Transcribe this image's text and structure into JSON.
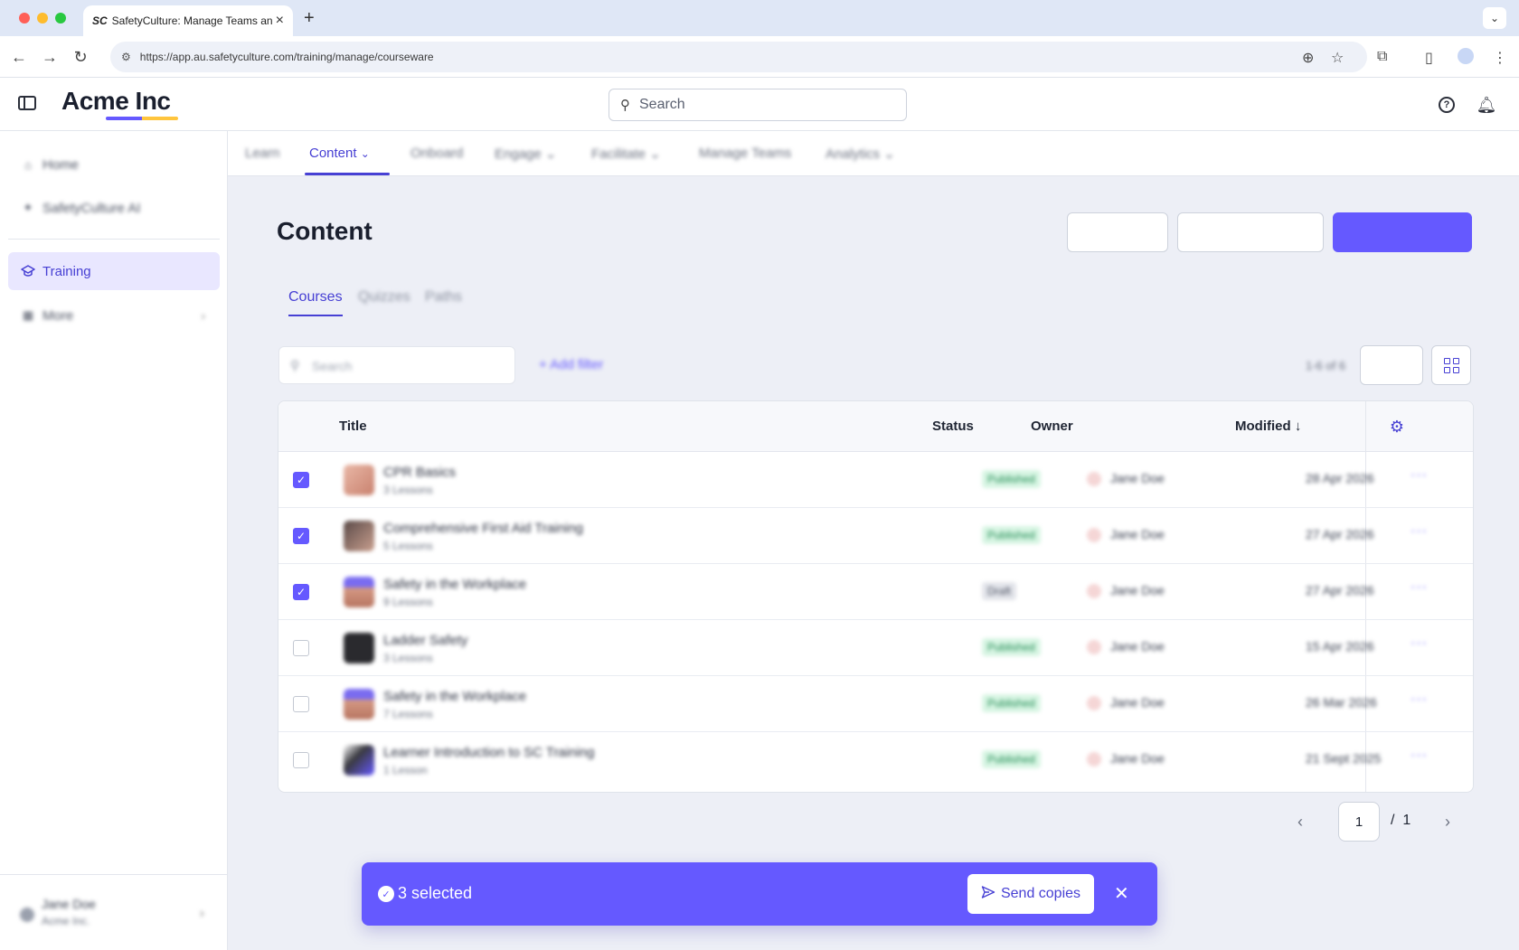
{
  "browser": {
    "tab_favicon": "SC",
    "tab_title": "SafetyCulture: Manage Teams and...",
    "url": "https://app.au.safetyculture.com/training/manage/courseware"
  },
  "header": {
    "logo": "Acme Inc",
    "search_placeholder": "Search"
  },
  "sidebar": {
    "items": [
      {
        "label": "Home",
        "icon": "home-icon"
      },
      {
        "label": "SafetyCulture AI",
        "icon": "ai-icon"
      },
      {
        "label": "Training",
        "icon": "graduation-cap-icon",
        "active": true
      },
      {
        "label": "More",
        "icon": "grid-icon"
      }
    ],
    "user": {
      "name": "Jane Doe",
      "org": "Acme Inc."
    }
  },
  "subnav": {
    "items": [
      "Learn",
      "Content",
      "Onboard",
      "Engage",
      "Facilitate",
      "Manage Teams",
      "Analytics"
    ],
    "active": "Content"
  },
  "page": {
    "title": "Content",
    "tabs": [
      "Courses",
      "Quizzes",
      "Paths"
    ],
    "search_placeholder": "Search",
    "add_filter": "+ Add filter",
    "count": "1-6 of 6"
  },
  "table": {
    "columns": [
      "Title",
      "Status",
      "Owner",
      "Modified"
    ],
    "rows": [
      {
        "title": "CPR Basics",
        "lessons": "3 Lessons",
        "status": "Published",
        "owner": "Jane Doe",
        "modified": "28 Apr 2026",
        "selected": true
      },
      {
        "title": "Comprehensive First Aid Training",
        "lessons": "5 Lessons",
        "status": "Published",
        "owner": "Jane Doe",
        "modified": "27 Apr 2026",
        "selected": true
      },
      {
        "title": "Safety in the Workplace",
        "lessons": "9 Lessons",
        "status": "Draft",
        "owner": "Jane Doe",
        "modified": "27 Apr 2026",
        "selected": true
      },
      {
        "title": "Ladder Safety",
        "lessons": "3 Lessons",
        "status": "Published",
        "owner": "Jane Doe",
        "modified": "15 Apr 2026",
        "selected": false
      },
      {
        "title": "Safety in the Workplace",
        "lessons": "7 Lessons",
        "status": "Published",
        "owner": "Jane Doe",
        "modified": "26 Mar 2026",
        "selected": false
      },
      {
        "title": "Learner Introduction to SC Training",
        "lessons": "1 Lesson",
        "status": "Published",
        "owner": "Jane Doe",
        "modified": "21 Sept 2025",
        "selected": false
      }
    ]
  },
  "pagination": {
    "current": "1",
    "separator": "/",
    "total": "1"
  },
  "selection": {
    "text": "3 selected",
    "send_label": "Send copies"
  },
  "colors": {
    "accent": "#6559ff",
    "accent_dark": "#4740d4"
  }
}
